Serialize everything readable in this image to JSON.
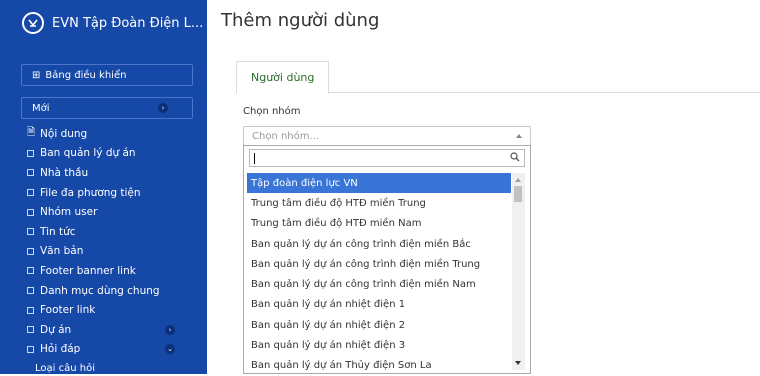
{
  "sidebar": {
    "brand_title": "EVN Tập Đoàn Điện L...",
    "dashboard_label": "Bảng điều khiển",
    "new_label": "Mới",
    "items": [
      {
        "label": "Nội dung"
      },
      {
        "label": "Ban quản lý dự án"
      },
      {
        "label": "Nhà thầu"
      },
      {
        "label": "File đa phương tiện"
      },
      {
        "label": "Nhóm user"
      },
      {
        "label": "Tin tức"
      },
      {
        "label": "Văn bản"
      },
      {
        "label": "Footer banner link"
      },
      {
        "label": "Danh mục dùng chung"
      },
      {
        "label": "Footer link"
      },
      {
        "label": "Dự án"
      },
      {
        "label": "Hỏi đáp"
      }
    ],
    "sub_item": "Loại câu hỏi"
  },
  "main": {
    "page_title": "Thêm người dùng",
    "tab_label": "Người dùng",
    "group_label": "Chọn nhóm",
    "select_placeholder": "Chọn nhóm...",
    "options": [
      "Tập đoàn điện lực VN",
      "Trung tâm điều độ HTĐ miền Trung",
      "Trung tâm điều độ HTĐ miền Nam",
      "Ban quản lý dự án công trình điện miền Bắc",
      "Ban quản lý dự án công trình điện miền Trung",
      "Ban quản lý dự án công trình điện miền Nam",
      "Ban quản lý dự án nhiệt điện 1",
      "Ban quản lý dự án nhiệt điện 2",
      "Ban quản lý dự án nhiệt điện 3",
      "Ban quản lý dự án Thủy điện Sơn La"
    ],
    "selected_option": "Tập đoàn điện lực VN"
  },
  "colors": {
    "sidebar_bg": "#1648a7",
    "selected_bg": "#3875d7",
    "tab_text": "#2b6a2b"
  }
}
